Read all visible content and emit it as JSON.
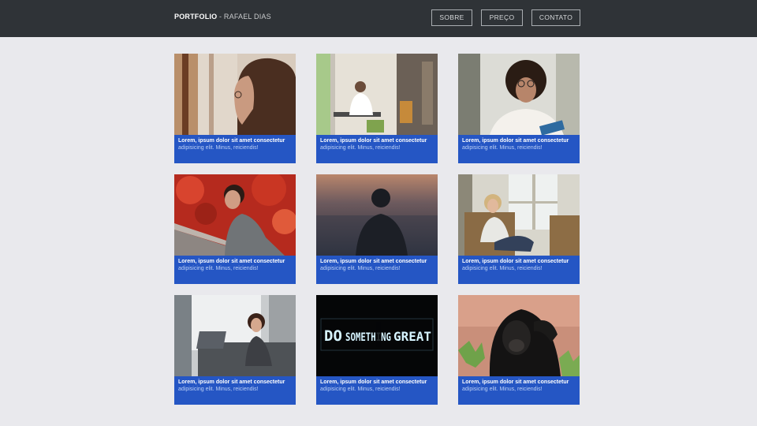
{
  "header": {
    "brand_bold": "PORTFOLIO",
    "brand_rest": " - RAFAEL DIAS",
    "nav": [
      {
        "label": "SOBRE"
      },
      {
        "label": "PREÇO"
      },
      {
        "label": "CONTATO"
      }
    ]
  },
  "cards": [
    {
      "title": "Lorem, ipsum dolor sit amet consectetur",
      "subtitle": "adipisicing elit. Minus, reiciendis!"
    },
    {
      "title": "Lorem, ipsum dolor sit amet consectetur",
      "subtitle": "adipisicing elit. Minus, reiciendis!"
    },
    {
      "title": "Lorem, ipsum dolor sit amet consectetur",
      "subtitle": "adipisicing elit. Minus, reiciendis!"
    },
    {
      "title": "Lorem, ipsum dolor sit amet consectetur",
      "subtitle": "adipisicing elit. Minus, reiciendis!"
    },
    {
      "title": "Lorem, ipsum dolor sit amet consectetur",
      "subtitle": "adipisicing elit. Minus, reiciendis!"
    },
    {
      "title": "Lorem, ipsum dolor sit amet consectetur",
      "subtitle": "adipisicing elit. Minus, reiciendis!"
    },
    {
      "title": "Lorem, ipsum dolor sit amet consectetur",
      "subtitle": "adipisicing elit. Minus, reiciendis!"
    },
    {
      "title": "Lorem, ipsum dolor sit amet consectetur",
      "subtitle": "adipisicing elit. Minus, reiciendis!"
    },
    {
      "title": "Lorem, ipsum dolor sit amet consectetur",
      "subtitle": "adipisicing elit. Minus, reiciendis!"
    }
  ],
  "neon_sign": {
    "left": "DO",
    "middle": "SOMETHING",
    "right": "GREAT"
  },
  "colors": {
    "header_bg": "#2f3337",
    "page_bg": "#e9e9ed",
    "card_caption_bg": "#2556c4"
  }
}
